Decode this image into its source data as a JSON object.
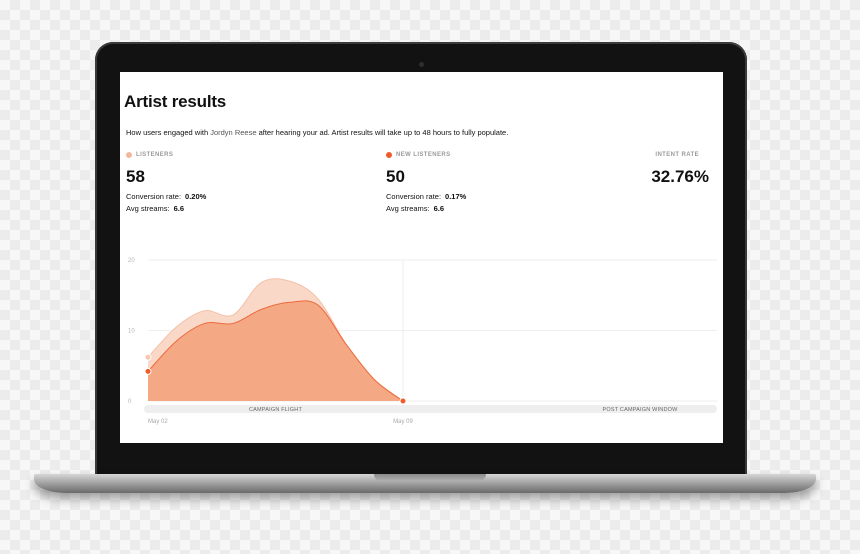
{
  "page": {
    "title": "Artist results",
    "subtitle_before": "How users engaged with ",
    "artist_name": "Jordyn Reese",
    "subtitle_after": " after hearing your ad. Artist results will take up to 48 hours to fully populate."
  },
  "metrics": {
    "listeners": {
      "label": "LISTENERS",
      "value": "58",
      "conversion_label": "Conversion rate:",
      "conversion_value": "0.20%",
      "streams_label": "Avg streams:",
      "streams_value": "6.6",
      "color": "#f3b79e"
    },
    "new_listeners": {
      "label": "NEW LISTENERS",
      "value": "50",
      "conversion_label": "Conversion rate:",
      "conversion_value": "0.17%",
      "streams_label": "Avg streams:",
      "streams_value": "6.6",
      "color": "#ef5c2a"
    },
    "intent": {
      "label": "INTENT RATE",
      "value": "32.76%"
    }
  },
  "chart_data": {
    "type": "area",
    "x": [
      0,
      1,
      2,
      3,
      4,
      5,
      6,
      7,
      8,
      9
    ],
    "x_tick_labels": [
      {
        "x": 0,
        "label": "May 02"
      },
      {
        "x": 9,
        "label": "May 09"
      }
    ],
    "ylim": [
      0,
      20
    ],
    "y_ticks": [
      "0",
      "10",
      "20"
    ],
    "grid": true,
    "series": [
      {
        "values": [
          6.2,
          10.5,
          12.8,
          12.2,
          16.8,
          17.0,
          14.5,
          8.0,
          3.0,
          0
        ],
        "color": "#f9d8c8"
      },
      {
        "values": [
          4.2,
          8.5,
          11.0,
          11.0,
          13.0,
          14.0,
          13.6,
          8.0,
          3.0,
          0
        ],
        "color": "#f4a883"
      }
    ],
    "periods": [
      {
        "label": "CAMPAIGN FLIGHT"
      },
      {
        "label": "POST CAMPAIGN WINDOW"
      }
    ]
  }
}
